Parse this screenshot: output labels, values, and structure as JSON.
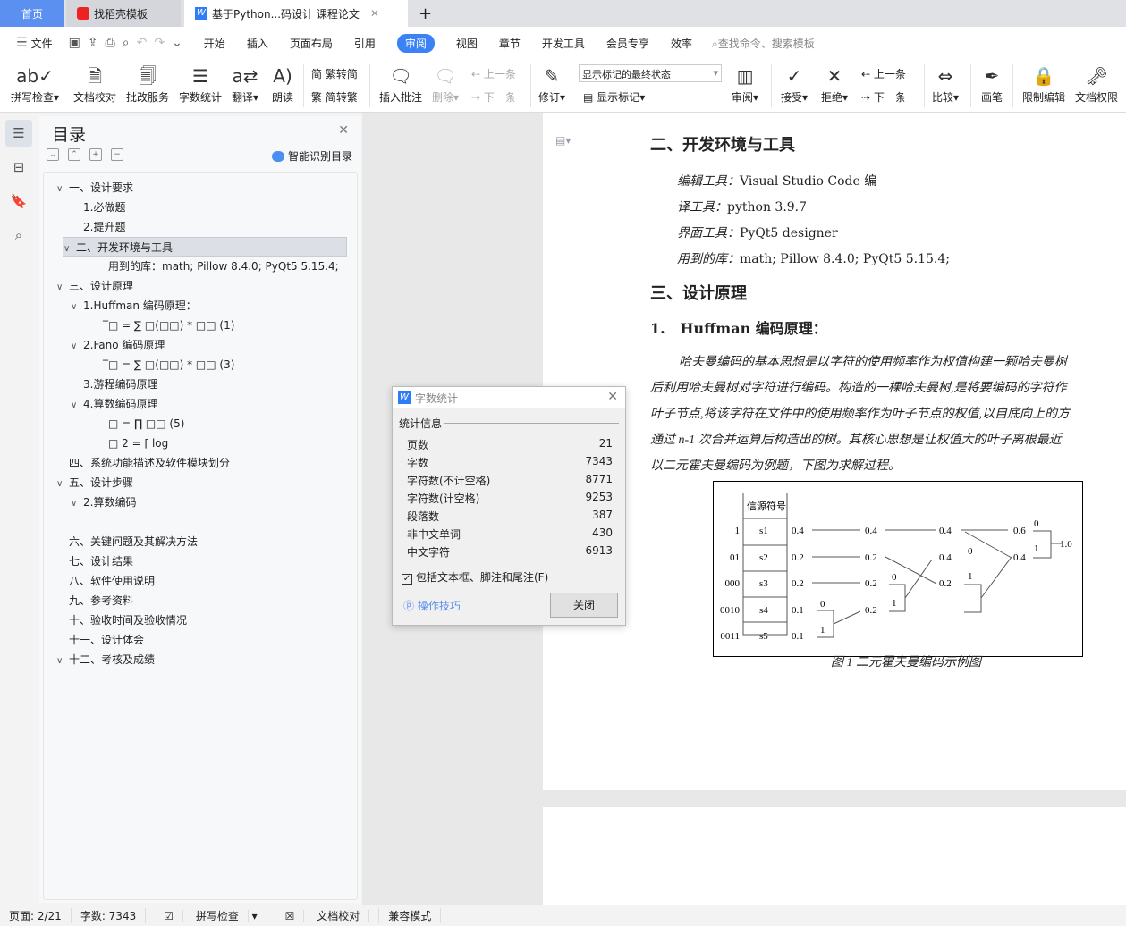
{
  "tabs": {
    "home": "首页",
    "template": "找稻壳模板",
    "doc": "基于Python...码设计 课程论文",
    "new": "+"
  },
  "menu": {
    "file": "文件",
    "items": [
      "开始",
      "插入",
      "页面布局",
      "引用",
      "审阅",
      "视图",
      "章节",
      "开发工具",
      "会员专享",
      "效率"
    ],
    "active": "审阅",
    "search_placeholder": "查找命令、搜索模板"
  },
  "ribbon": {
    "spell": "拼写检查",
    "proof": "文档校对",
    "review_service": "批改服务",
    "word_count": "字数统计",
    "translate": "翻译",
    "read": "朗读",
    "t2s": "繁转简",
    "s2t": "简转繁",
    "insert_comment": "插入批注",
    "delete": "删除",
    "prev": "上一条",
    "next": "下一条",
    "revise": "修订",
    "markup_state": "显示标记的最终状态",
    "show_markup": "显示标记",
    "review": "审阅",
    "accept": "接受",
    "reject": "拒绝",
    "prev2": "上一条",
    "next2": "下一条",
    "compare": "比较",
    "pen": "画笔",
    "restrict": "限制编辑",
    "rights": "文档权限"
  },
  "toc": {
    "title": "目录",
    "smart": "智能识别目录",
    "items": [
      {
        "text": "一、设计要求",
        "level": 0,
        "caret": true
      },
      {
        "text": "1.必做题",
        "level": 1,
        "caret": false
      },
      {
        "text": "2.提升题",
        "level": 1,
        "caret": false
      },
      {
        "text": "二、开发环境与工具",
        "level": 0,
        "caret": true,
        "selected": true
      },
      {
        "text": "用到的库：math; Pillow 8.4.0; PyQt5 5.15.4;",
        "level": 2,
        "caret": false
      },
      {
        "text": "三、设计原理",
        "level": 0,
        "caret": true
      },
      {
        "text": "1.Huffman 编码原理：",
        "level": 1,
        "caret": true
      },
      {
        "text": "̅□ =  ∑ □(□□) *    □□   (1)",
        "level": 2,
        "caret": false
      },
      {
        "text": "2.Fano 编码原理",
        "level": 1,
        "caret": true
      },
      {
        "text": "̅□ =  ∑ □(□□) *    □□   (3)",
        "level": 2,
        "caret": false
      },
      {
        "text": "3.游程编码原理",
        "level": 1,
        "caret": false
      },
      {
        "text": "4.算数编码原理",
        "level": 1,
        "caret": true
      },
      {
        "text": "□ = ∏ □□   (5)",
        "level": 2,
        "caret": false
      },
      {
        "text": "□        2 = ⌈  log",
        "level": 2,
        "caret": false
      },
      {
        "text": "四、系统功能描述及软件模块划分",
        "level": 0,
        "caret": false
      },
      {
        "text": "五、设计步骤",
        "level": 0,
        "caret": true
      },
      {
        "text": "2.算数编码",
        "level": 1,
        "caret": true
      },
      {
        "text": "",
        "level": 1,
        "caret": false
      },
      {
        "text": "六、关键问题及其解决方法",
        "level": 0,
        "caret": false
      },
      {
        "text": "七、设计结果",
        "level": 0,
        "caret": false
      },
      {
        "text": "八、软件使用说明",
        "level": 0,
        "caret": false
      },
      {
        "text": "九、参考资料",
        "level": 0,
        "caret": false
      },
      {
        "text": "十、验收时间及验收情况",
        "level": 0,
        "caret": false
      },
      {
        "text": "十一、设计体会",
        "level": 0,
        "caret": false
      },
      {
        "text": "十二、考核及成绩",
        "level": 0,
        "caret": true
      }
    ]
  },
  "doc": {
    "h_env": "二、开发环境与工具",
    "env_lines": [
      {
        "label": "编辑工具：",
        "value": "Visual Studio Code 编"
      },
      {
        "label": "译工具：",
        "value": "python 3.9.7"
      },
      {
        "label": "界面工具：",
        "value": "PyQt5 designer"
      },
      {
        "label": "用到的库：",
        "value": "math; Pillow 8.4.0; PyQt5 5.15.4;"
      }
    ],
    "h_principle": "三、设计原理",
    "h_huffman_num": "1.",
    "h_huffman": "Huffman 编码原理：",
    "para": [
      "哈夫曼编码的基本思想是以字符的使用频率作为权值构建一颗哈夫曼树",
      "后利用哈夫曼树对字符进行编码。构造的一棵哈夫曼树,是将要编码的字符作",
      "叶子节点,将该字符在文件中的使用频率作为叶子节点的权值,以自底向上的方",
      "通过 n-1  次合并运算后构造出的树。其核心思想是让权值大的叶子离根最近",
      "以二元霍夫曼编码为例题，下图为求解过程。"
    ],
    "figure": {
      "header": "信源符号",
      "codes": [
        "1",
        "01",
        "000",
        "0010",
        "0011"
      ],
      "symbols": [
        "s1",
        "s2",
        "s3",
        "s4",
        "s5"
      ],
      "col1": [
        "0.4",
        "0.2",
        "0.2",
        "0.1",
        "0.1"
      ],
      "col2": [
        "0.4",
        "0.2",
        "0.2",
        "0.2"
      ],
      "col3": [
        "0.4",
        "0.4",
        "0.2"
      ],
      "col4": [
        "0.6",
        "0.4"
      ],
      "root": "1.0",
      "bit0": "0",
      "bit1": "1"
    },
    "caption": "图 1  二元霍夫曼编码示例图"
  },
  "dialog": {
    "title": "字数统计",
    "group": "统计信息",
    "rows": [
      {
        "label": "页数",
        "value": "21"
      },
      {
        "label": "字数",
        "value": "7343"
      },
      {
        "label": "字符数(不计空格)",
        "value": "8771"
      },
      {
        "label": "字符数(计空格)",
        "value": "9253"
      },
      {
        "label": "段落数",
        "value": "387"
      },
      {
        "label": "非中文单词",
        "value": "430"
      },
      {
        "label": "中文字符",
        "value": "6913"
      }
    ],
    "include": "包括文本框、脚注和尾注(F)",
    "include_checked": true,
    "tips": "操作技巧",
    "close": "关闭"
  },
  "status": {
    "page": "页面: 2/21",
    "words": "字数: 7343",
    "spell": "拼写检查",
    "proof": "文档校对",
    "compat": "兼容模式"
  }
}
